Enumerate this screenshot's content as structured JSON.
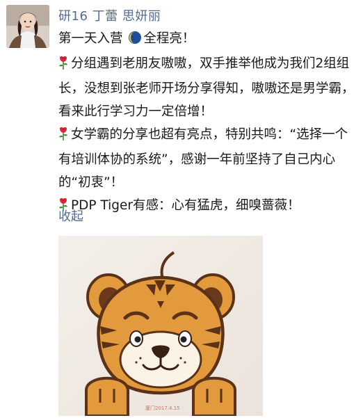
{
  "author": {
    "name": "研16 丁蕾 思妍丽"
  },
  "post": {
    "lines": [
      "第一天入营",
      "全程亮！",
      "分组遇到老朋友嗷嗷，双手推举他成为我们2组组长，没想到张老师开场分享得知，嗷嗷还是男学霸，看来此行学习力一定倍增！",
      "女学霸的分享也超有亮点，特别共鸣：“选择一个有培训体协的系统”，感谢一年前坚持了自己内心的“初衷”！",
      "PDP Tiger有感：心有猛虎，细嗅蔷薇！"
    ],
    "collapse_label": "收起"
  },
  "icons": {
    "rose": "rose-icon",
    "moon": "moon-face-icon"
  },
  "colors": {
    "link": "#576b95",
    "text": "#1a1a1a",
    "tiger_orange": "#e39a3c"
  },
  "image": {
    "watermark": "厦门2017.4.15"
  }
}
